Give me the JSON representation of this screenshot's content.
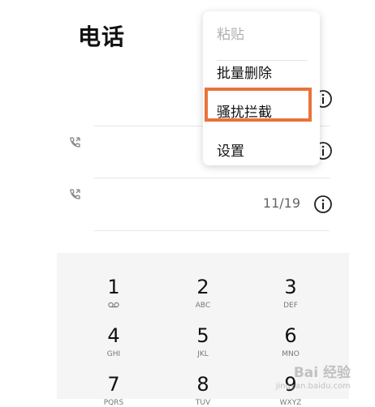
{
  "header": {
    "title": "电话"
  },
  "menu": {
    "items": [
      {
        "label": "粘贴",
        "disabled": true
      },
      {
        "label": "批量删除",
        "disabled": false
      },
      {
        "label": "骚扰拦截",
        "disabled": false
      },
      {
        "label": "设置",
        "disabled": false
      }
    ]
  },
  "calls": [
    {
      "date": ""
    },
    {
      "date": "11/19"
    }
  ],
  "dialpad": {
    "keys": [
      {
        "digit": "1",
        "letters": ""
      },
      {
        "digit": "2",
        "letters": "ABC"
      },
      {
        "digit": "3",
        "letters": "DEF"
      },
      {
        "digit": "4",
        "letters": "GHI"
      },
      {
        "digit": "5",
        "letters": "JKL"
      },
      {
        "digit": "6",
        "letters": "MNO"
      },
      {
        "digit": "7",
        "letters": "PQRS"
      },
      {
        "digit": "8",
        "letters": "TUV"
      },
      {
        "digit": "9",
        "letters": "WXYZ"
      }
    ]
  },
  "watermark": {
    "text": "Bai 经验",
    "sub": "jingyan.baidu.com"
  },
  "colors": {
    "highlight": "#e9733a",
    "dialpad_bg": "#f5f5f5"
  }
}
